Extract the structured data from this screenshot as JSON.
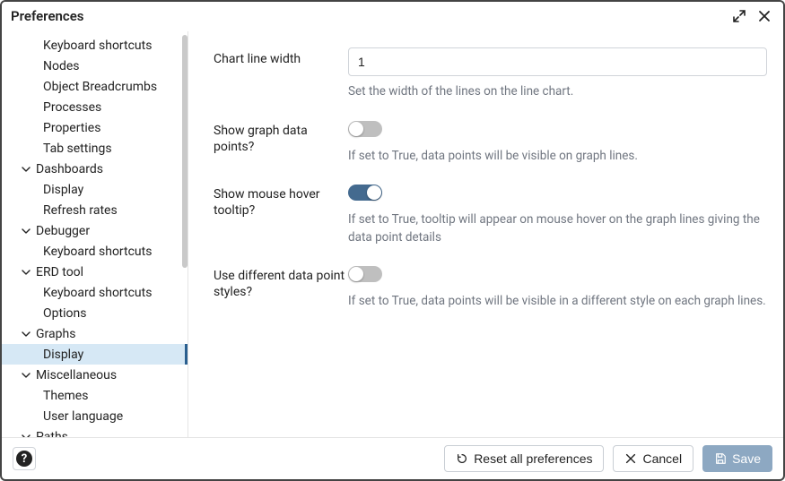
{
  "window": {
    "title": "Preferences"
  },
  "sidebar": {
    "items": [
      {
        "label": "Keyboard shortcuts",
        "level": "child"
      },
      {
        "label": "Nodes",
        "level": "child"
      },
      {
        "label": "Object Breadcrumbs",
        "level": "child"
      },
      {
        "label": "Processes",
        "level": "child"
      },
      {
        "label": "Properties",
        "level": "child"
      },
      {
        "label": "Tab settings",
        "level": "child"
      },
      {
        "label": "Dashboards",
        "level": "parent"
      },
      {
        "label": "Display",
        "level": "child"
      },
      {
        "label": "Refresh rates",
        "level": "child"
      },
      {
        "label": "Debugger",
        "level": "parent"
      },
      {
        "label": "Keyboard shortcuts",
        "level": "child"
      },
      {
        "label": "ERD tool",
        "level": "parent"
      },
      {
        "label": "Keyboard shortcuts",
        "level": "child"
      },
      {
        "label": "Options",
        "level": "child"
      },
      {
        "label": "Graphs",
        "level": "parent"
      },
      {
        "label": "Display",
        "level": "child",
        "selected": true
      },
      {
        "label": "Miscellaneous",
        "level": "parent"
      },
      {
        "label": "Themes",
        "level": "child"
      },
      {
        "label": "User language",
        "level": "child"
      },
      {
        "label": "Paths",
        "level": "parent"
      }
    ]
  },
  "form": {
    "chart_line_width": {
      "label": "Chart line width",
      "value": "1",
      "help": "Set the width of the lines on the line chart."
    },
    "show_data_points": {
      "label": "Show graph data points?",
      "on": false,
      "help": "If set to True, data points will be visible on graph lines."
    },
    "show_tooltip": {
      "label": "Show mouse hover tooltip?",
      "on": true,
      "help": "If set to True, tooltip will appear on mouse hover on the graph lines giving the data point details"
    },
    "diff_point_styles": {
      "label": "Use different data point styles?",
      "on": false,
      "help": "If set to True, data points will be visible in a different style on each graph lines."
    }
  },
  "footer": {
    "reset": "Reset all preferences",
    "cancel": "Cancel",
    "save": "Save"
  }
}
